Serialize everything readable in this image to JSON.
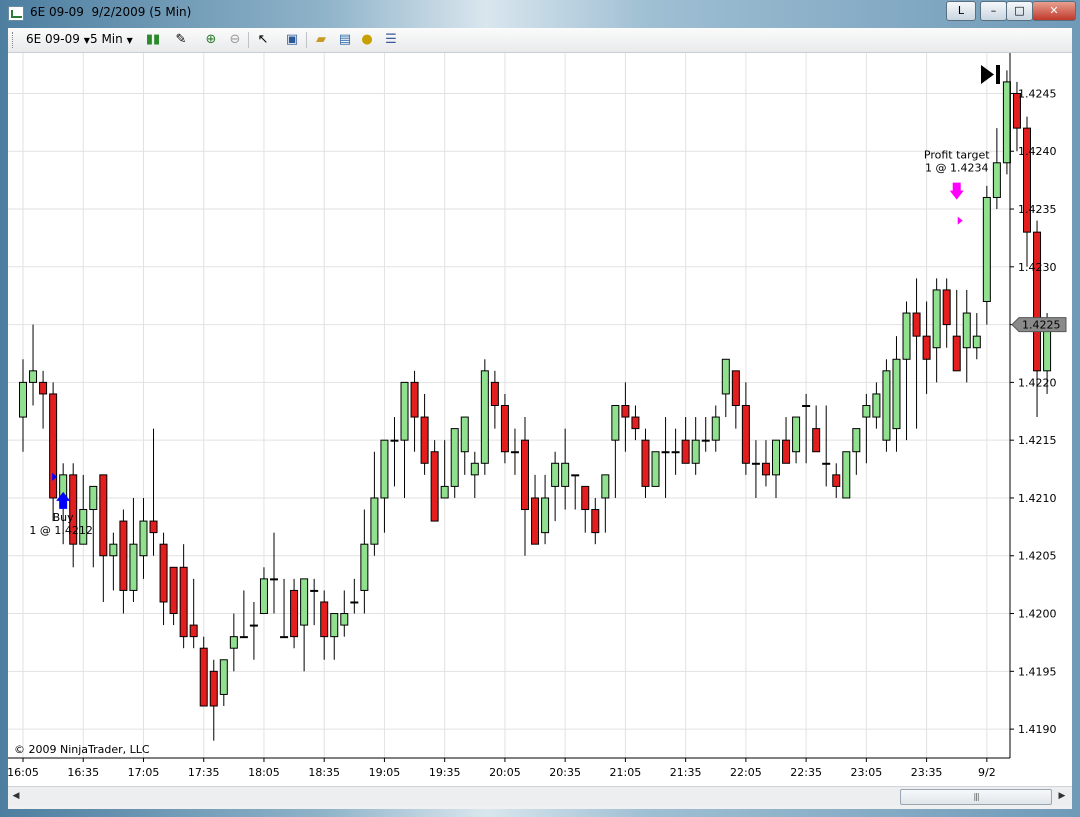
{
  "window": {
    "title": "6E 09-09  9/2/2009 (5 Min)",
    "btn_l": "L",
    "btn_min": "–",
    "btn_max": "□",
    "btn_close": "✕"
  },
  "toolbar": {
    "instrument": "6E 09-09",
    "interval": "5 Min",
    "icons": [
      "candlestick-icon",
      "pencil-icon",
      "zoom-in-icon",
      "zoom-out-icon",
      "cursor-icon",
      "properties-icon",
      "folder-icon",
      "chart-icon",
      "dollar-icon",
      "list-icon"
    ]
  },
  "chart": {
    "copyright": "© 2009 NinjaTrader, LLC",
    "last_price": "1.4225",
    "last_price_value": 1.4225,
    "price_ticks": [
      "1.4190",
      "1.4195",
      "1.4200",
      "1.4205",
      "1.4210",
      "1.4215",
      "1.4220",
      "1.4225",
      "1.4230",
      "1.4235",
      "1.4240",
      "1.4245"
    ],
    "time_ticks": [
      "16:05",
      "16:35",
      "17:05",
      "17:35",
      "18:05",
      "18:35",
      "19:05",
      "19:35",
      "20:05",
      "20:35",
      "21:05",
      "21:35",
      "22:05",
      "22:35",
      "23:05",
      "23:35",
      "9/2"
    ],
    "buy_label": "Buy",
    "buy_detail": "1 @ 1.4212",
    "buy_price": 1.4212,
    "buy_bar": 4,
    "target_label": "Profit target",
    "target_detail": "1 @ 1.4234",
    "target_price": 1.4234,
    "target_bar": 93,
    "colors": {
      "up": "#90e090",
      "down": "#e21e1e",
      "wick": "#000000",
      "arrow_buy": "#0000ff",
      "arrow_target": "#ff00ff",
      "grid": "#e2e2e2"
    }
  },
  "chart_data": {
    "type": "candlestick",
    "ylim": [
      1.41875,
      1.42485
    ],
    "candles": [
      [
        1.4217,
        1.4222,
        1.4214,
        1.422
      ],
      [
        1.422,
        1.4225,
        1.4218,
        1.4221
      ],
      [
        1.422,
        1.4221,
        1.4216,
        1.4219
      ],
      [
        1.4219,
        1.422,
        1.4208,
        1.421
      ],
      [
        1.421,
        1.4213,
        1.4206,
        1.4212
      ],
      [
        1.4212,
        1.4213,
        1.4204,
        1.4206
      ],
      [
        1.4206,
        1.4212,
        1.4206,
        1.4209
      ],
      [
        1.4209,
        1.4211,
        1.4204,
        1.4211
      ],
      [
        1.4212,
        1.4212,
        1.4201,
        1.4205
      ],
      [
        1.4205,
        1.4207,
        1.4202,
        1.4206
      ],
      [
        1.4208,
        1.4209,
        1.42,
        1.4202
      ],
      [
        1.4202,
        1.421,
        1.4201,
        1.4206
      ],
      [
        1.4205,
        1.421,
        1.4203,
        1.4208
      ],
      [
        1.4208,
        1.4216,
        1.4205,
        1.4207
      ],
      [
        1.4206,
        1.4207,
        1.4199,
        1.4201
      ],
      [
        1.4204,
        1.4204,
        1.4199,
        1.42
      ],
      [
        1.4204,
        1.4206,
        1.4197,
        1.4198
      ],
      [
        1.4199,
        1.4203,
        1.4197,
        1.4198
      ],
      [
        1.4197,
        1.4198,
        1.4192,
        1.4192
      ],
      [
        1.4195,
        1.4196,
        1.4189,
        1.4192
      ],
      [
        1.4193,
        1.4196,
        1.4192,
        1.4196
      ],
      [
        1.4197,
        1.42,
        1.4195,
        1.4198
      ],
      [
        1.4198,
        1.4202,
        1.4198,
        1.4198
      ],
      [
        1.4199,
        1.4201,
        1.4196,
        1.4199
      ],
      [
        1.42,
        1.4204,
        1.42,
        1.4203
      ],
      [
        1.4203,
        1.4207,
        1.42,
        1.4203
      ],
      [
        1.4198,
        1.4203,
        1.4198,
        1.4198
      ],
      [
        1.4202,
        1.4203,
        1.4197,
        1.4198
      ],
      [
        1.4199,
        1.4202,
        1.4195,
        1.4203
      ],
      [
        1.4202,
        1.4203,
        1.4199,
        1.4202
      ],
      [
        1.4201,
        1.4202,
        1.4196,
        1.4198
      ],
      [
        1.4198,
        1.42,
        1.4196,
        1.42
      ],
      [
        1.4199,
        1.4202,
        1.4198,
        1.42
      ],
      [
        1.4201,
        1.4203,
        1.42,
        1.4201
      ],
      [
        1.4202,
        1.4209,
        1.42,
        1.4206
      ],
      [
        1.4206,
        1.4214,
        1.4205,
        1.421
      ],
      [
        1.421,
        1.4215,
        1.4207,
        1.4215
      ],
      [
        1.4215,
        1.4217,
        1.4211,
        1.4215
      ],
      [
        1.4215,
        1.4217,
        1.421,
        1.422
      ],
      [
        1.422,
        1.4221,
        1.4214,
        1.4217
      ],
      [
        1.4217,
        1.4219,
        1.4212,
        1.4213
      ],
      [
        1.4214,
        1.4215,
        1.4208,
        1.4208
      ],
      [
        1.421,
        1.4215,
        1.421,
        1.4211
      ],
      [
        1.4211,
        1.4216,
        1.421,
        1.4216
      ],
      [
        1.4214,
        1.4217,
        1.4212,
        1.4217
      ],
      [
        1.4212,
        1.4214,
        1.421,
        1.4213
      ],
      [
        1.4213,
        1.4222,
        1.4212,
        1.4221
      ],
      [
        1.422,
        1.4221,
        1.4216,
        1.4218
      ],
      [
        1.4218,
        1.4219,
        1.4213,
        1.4214
      ],
      [
        1.4214,
        1.4216,
        1.4212,
        1.4214
      ],
      [
        1.4215,
        1.4217,
        1.4205,
        1.4209
      ],
      [
        1.421,
        1.4212,
        1.4206,
        1.4206
      ],
      [
        1.4207,
        1.4212,
        1.4206,
        1.421
      ],
      [
        1.4211,
        1.4214,
        1.4208,
        1.4213
      ],
      [
        1.4211,
        1.4216,
        1.4209,
        1.4213
      ],
      [
        1.4212,
        1.4212,
        1.4209,
        1.4212
      ],
      [
        1.4211,
        1.4211,
        1.4207,
        1.4209
      ],
      [
        1.4209,
        1.421,
        1.4206,
        1.4207
      ],
      [
        1.421,
        1.4212,
        1.4207,
        1.4212
      ],
      [
        1.4215,
        1.4217,
        1.421,
        1.4218
      ],
      [
        1.4218,
        1.422,
        1.4214,
        1.4217
      ],
      [
        1.4217,
        1.4218,
        1.4215,
        1.4216
      ],
      [
        1.4215,
        1.4216,
        1.421,
        1.4211
      ],
      [
        1.4211,
        1.4214,
        1.4211,
        1.4214
      ],
      [
        1.4214,
        1.4217,
        1.421,
        1.4214
      ],
      [
        1.4214,
        1.4216,
        1.4212,
        1.4214
      ],
      [
        1.4215,
        1.4217,
        1.4213,
        1.4213
      ],
      [
        1.4213,
        1.4217,
        1.4212,
        1.4215
      ],
      [
        1.4215,
        1.4217,
        1.4214,
        1.4215
      ],
      [
        1.4215,
        1.4218,
        1.4214,
        1.4217
      ],
      [
        1.4219,
        1.4222,
        1.4217,
        1.4222
      ],
      [
        1.4221,
        1.4221,
        1.4216,
        1.4218
      ],
      [
        1.4218,
        1.422,
        1.4212,
        1.4213
      ],
      [
        1.4213,
        1.4215,
        1.421,
        1.4213
      ],
      [
        1.4213,
        1.4215,
        1.4211,
        1.4212
      ],
      [
        1.4212,
        1.4215,
        1.421,
        1.4215
      ],
      [
        1.4215,
        1.4217,
        1.4213,
        1.4213
      ],
      [
        1.4214,
        1.4217,
        1.4213,
        1.4217
      ],
      [
        1.4218,
        1.4219,
        1.4213,
        1.4218
      ],
      [
        1.4216,
        1.4218,
        1.4214,
        1.4214
      ],
      [
        1.4213,
        1.4218,
        1.4211,
        1.4213
      ],
      [
        1.4212,
        1.4213,
        1.421,
        1.4211
      ],
      [
        1.421,
        1.4214,
        1.421,
        1.4214
      ],
      [
        1.4214,
        1.4216,
        1.4212,
        1.4216
      ],
      [
        1.4217,
        1.4219,
        1.4213,
        1.4218
      ],
      [
        1.4217,
        1.422,
        1.4216,
        1.4219
      ],
      [
        1.4215,
        1.4222,
        1.4214,
        1.4221
      ],
      [
        1.4216,
        1.4224,
        1.4214,
        1.4222
      ],
      [
        1.4222,
        1.4227,
        1.4215,
        1.4226
      ],
      [
        1.4226,
        1.4229,
        1.4216,
        1.4224
      ],
      [
        1.4224,
        1.4227,
        1.4219,
        1.4222
      ],
      [
        1.4223,
        1.4229,
        1.422,
        1.4228
      ],
      [
        1.4228,
        1.4229,
        1.4223,
        1.4225
      ],
      [
        1.4224,
        1.4228,
        1.4221,
        1.4221
      ],
      [
        1.4223,
        1.4228,
        1.422,
        1.4226
      ],
      [
        1.4223,
        1.4226,
        1.4222,
        1.4224
      ],
      [
        1.4227,
        1.4237,
        1.4225,
        1.4236
      ],
      [
        1.4236,
        1.4242,
        1.4235,
        1.4239
      ],
      [
        1.4239,
        1.4247,
        1.4238,
        1.4246
      ],
      [
        1.4245,
        1.4246,
        1.424,
        1.4242
      ],
      [
        1.4242,
        1.4243,
        1.423,
        1.4233
      ],
      [
        1.4233,
        1.4234,
        1.4217,
        1.4221
      ],
      [
        1.4221,
        1.4226,
        1.4219,
        1.4225
      ]
    ]
  }
}
